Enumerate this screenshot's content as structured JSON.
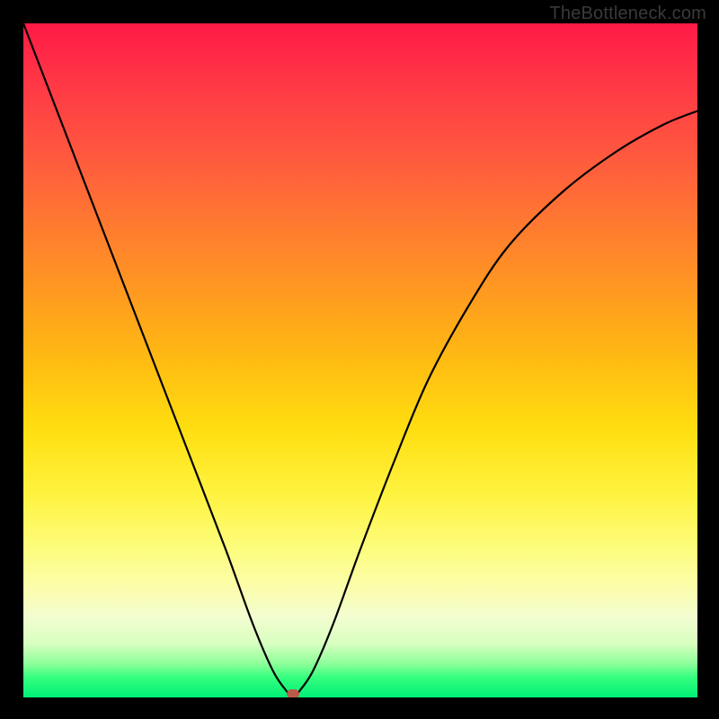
{
  "watermark": "TheBottleneck.com",
  "chart_data": {
    "type": "line",
    "title": "",
    "xlabel": "",
    "ylabel": "",
    "xlim": [
      0,
      100
    ],
    "ylim": [
      0,
      100
    ],
    "grid": false,
    "legend": false,
    "background_gradient": {
      "top_color": "#ff1a46",
      "bottom_color": "#00ef77",
      "description": "red-to-green vertical gradient (red=high bottleneck, green=low)"
    },
    "series": [
      {
        "name": "bottleneck-curve",
        "color": "#000000",
        "x": [
          0,
          5,
          10,
          15,
          20,
          25,
          30,
          34,
          37,
          39,
          40,
          41,
          43,
          46,
          50,
          55,
          60,
          66,
          72,
          80,
          88,
          95,
          100
        ],
        "values": [
          100,
          87,
          74,
          61,
          48,
          35,
          22,
          11,
          4,
          1,
          0,
          1,
          4,
          11,
          22,
          35,
          47,
          58,
          67,
          75,
          81,
          85,
          87
        ]
      }
    ],
    "marker": {
      "x": 40,
      "y": 0.5,
      "color": "#bb5a4a",
      "label": ""
    }
  }
}
